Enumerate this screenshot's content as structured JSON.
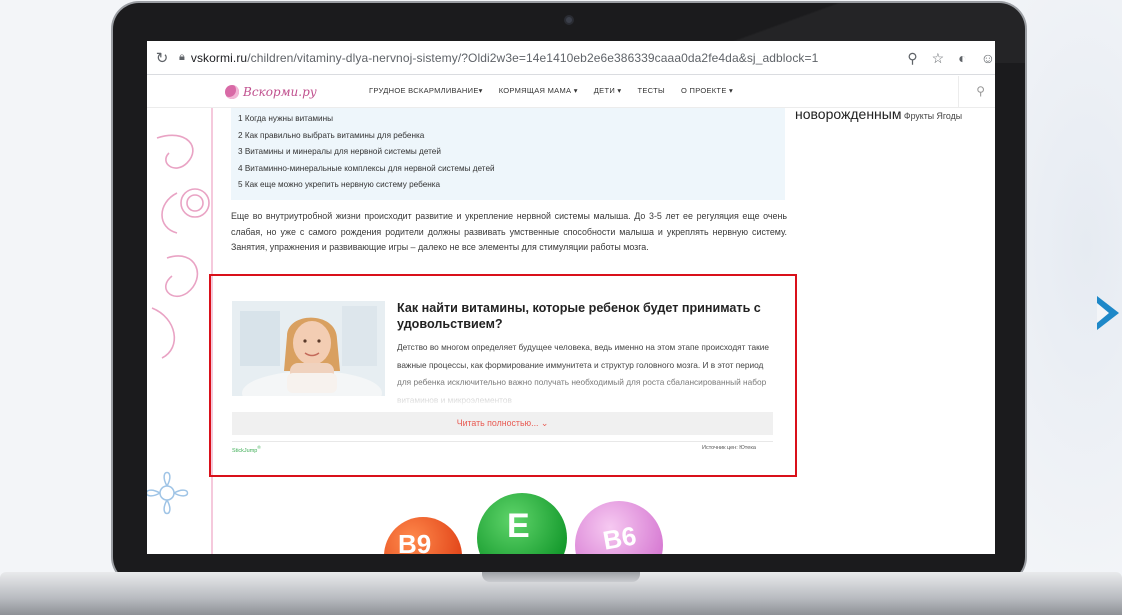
{
  "browser": {
    "url_host": "vskormi.ru",
    "url_path": "/children/vitaminy-dlya-nervnoj-sistemy/?Oldi2w3e=14e1410eb2e6e386339caaa0da2fe4da&sj_adblock=1",
    "icons": [
      "reload-icon",
      "lock-icon",
      "zoom-icon",
      "star-icon",
      "extension-icon",
      "profile-icon"
    ]
  },
  "site": {
    "logo_text": "Вскорми.ру",
    "menu": [
      "ГРУДНОЕ ВСКАРМЛИВАНИЕ▾",
      "КОРМЯЩАЯ МАМА ▾",
      "ДЕТИ ▾",
      "ТЕСТЫ",
      "О ПРОЕКТЕ ▾"
    ]
  },
  "toc": [
    "1 Когда нужны витамины",
    "2 Как правильно выбрать витамины для ребенка",
    "3 Витамины и минералы для нервной системы детей",
    "4 Витаминно-минеральные комплексы для нервной системы детей",
    "5 Как еще можно укрепить нервную систему ребенка"
  ],
  "article": {
    "paragraph": "Еще во внутриутробной жизни происходит развитие и укрепление нервной системы малыша. До 3-5 лет ее регуляция еще очень слабая, но уже с самого рождения родители должны развивать умственные способности малыша и укреплять нервную систему. Занятия, упражнения и развивающие игры – далеко не все элементы для стимуляции работы мозга."
  },
  "promo": {
    "title": "Как найти витамины, которые ребенок будет принимать с удовольствием?",
    "text": "Детство во многом определяет будущее человека, ведь именно на этом этапе происходят такие важные процессы, как формирование иммунитета и структур головного мозга. И в этот период для ребенка исключительно важно получать необходимый для роста сбалансированный набор витаминов и микроэлементов",
    "read_more": "Читать полностью... ⌄",
    "brand": "StickJump",
    "brand_mark": "®",
    "source": "Источник цен: Ютека"
  },
  "sidebar": {
    "big": "новорожденным",
    "rest": " Фрукты Ягоды"
  },
  "vitamins": [
    "B9",
    "E",
    "B6"
  ],
  "colors": {
    "frame": "#d9101a",
    "read_more": "#e85b53",
    "toc_bg": "#eef6fb",
    "accent_arrow": "#1e88c8",
    "logo": "#c0508e"
  }
}
